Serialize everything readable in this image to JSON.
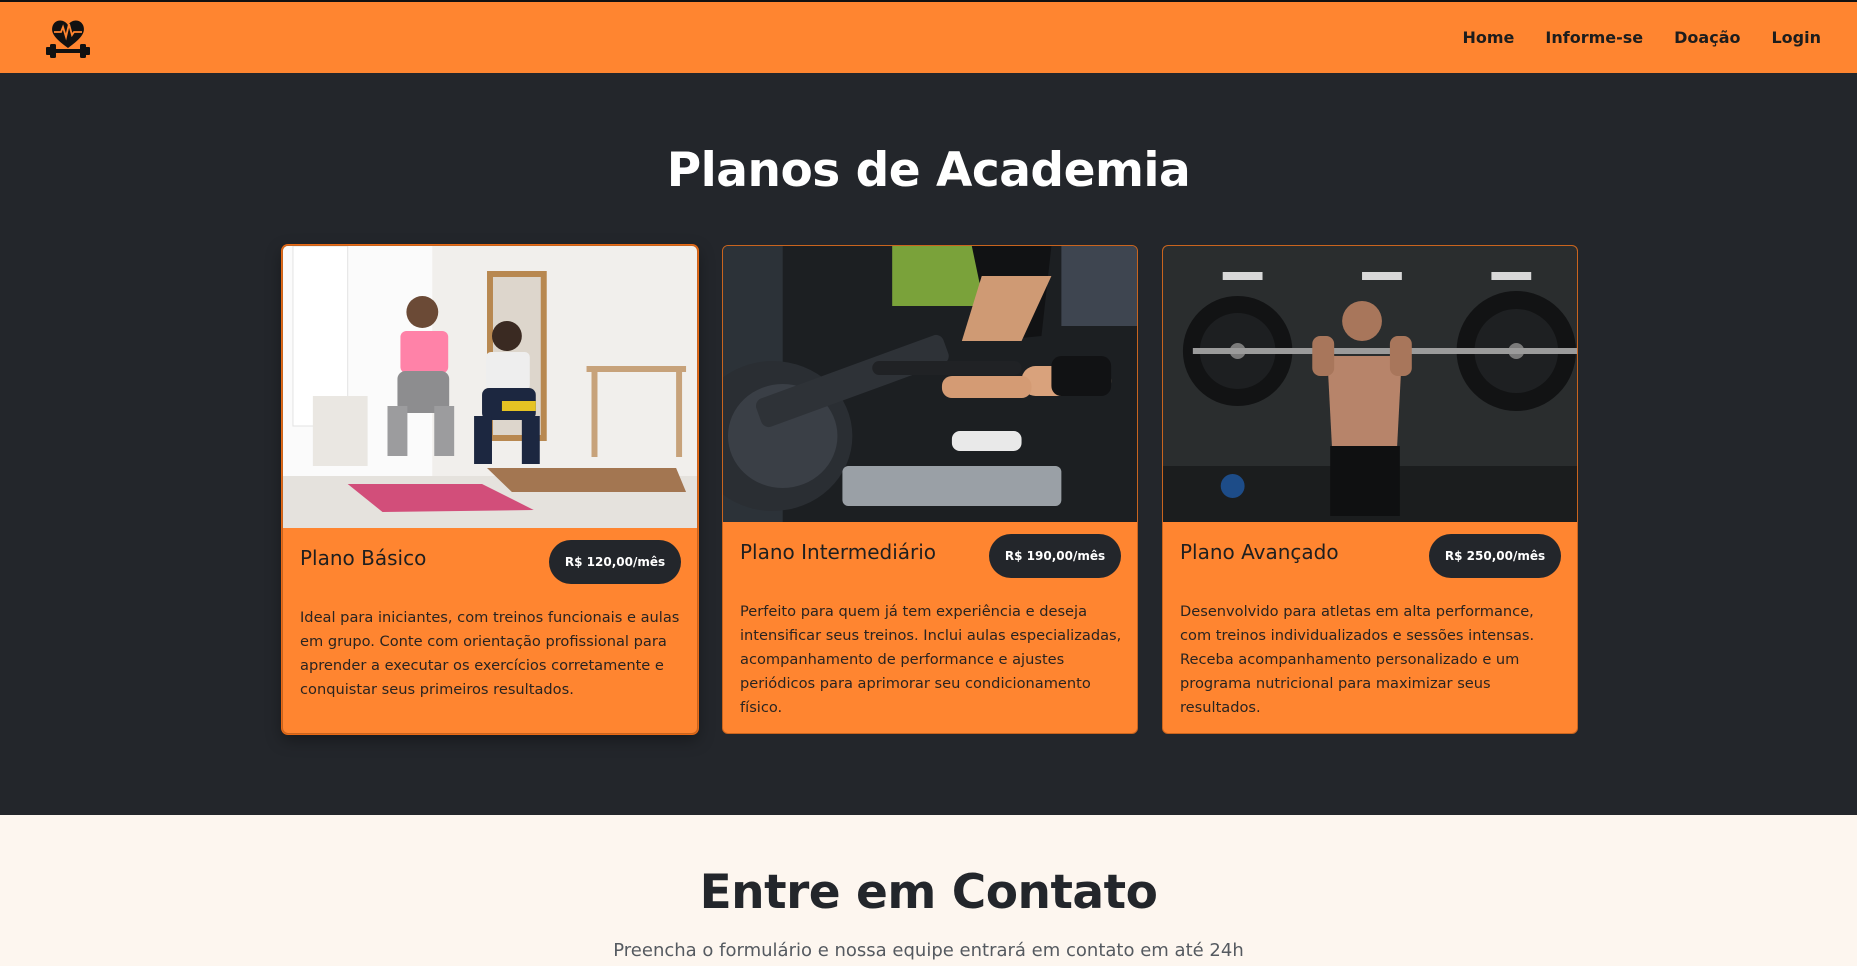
{
  "nav": {
    "logo_icon": "heart-dumbbell-logo-icon",
    "links": [
      "Home",
      "Informe-se",
      "Doação",
      "Login"
    ]
  },
  "plans": {
    "title": "Planos de Academia",
    "cards": [
      {
        "name": "Plano Básico",
        "price": "R$ 120,00/mês",
        "description": "Ideal para iniciantes, com treinos funcionais e aulas em grupo. Conte com orientação profissional para aprender a executar os exercícios corretamente e conquistar seus primeiros resultados.",
        "image": "woman-and-child-squatting-photo"
      },
      {
        "name": "Plano Intermediário",
        "price": "R$ 190,00/mês",
        "description": "Perfeito para quem já tem experiência e deseja intensificar seus treinos. Inclui aulas especializadas, acompanhamento de performance e ajustes periódicos para aprimorar seu condicionamento físico.",
        "image": "woman-rowing-machine-photo"
      },
      {
        "name": "Plano Avançado",
        "price": "R$ 250,00/mês",
        "description": "Desenvolvido para atletas em alta performance, com treinos individualizados e sessões intensas. Receba acompanhamento personalizado e um programa nutricional para maximizar seus resultados.",
        "image": "man-lifting-barbell-photo"
      }
    ]
  },
  "contact": {
    "title": "Entre em Contato",
    "subtitle": "Preencha o formulário e nossa equipe entrará em contato em até 24h"
  },
  "colors": {
    "accent": "#ff8530",
    "dark": "#23262b",
    "light_bg": "#fdf6ef"
  }
}
